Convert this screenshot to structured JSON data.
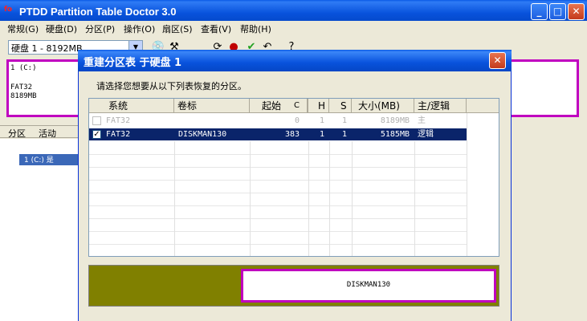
{
  "window": {
    "icon_text": "fo",
    "title": "PTDD Partition Table Doctor 3.0",
    "minimize_glyph": "_",
    "maximize_glyph": "□",
    "close_glyph": "✕"
  },
  "menu": [
    "常规(G)",
    "硬盘(D)",
    "分区(P)",
    "操作(O)",
    "扇区(S)",
    "查看(V)",
    "帮助(H)"
  ],
  "toolbar": {
    "disk_select": "硬盘 1 - 8192MB",
    "icons": [
      "disk-icon",
      "tools-icon",
      "separator",
      "refresh-icon",
      "stop-icon",
      "check-icon",
      "undo-icon",
      "separator",
      "help-icon"
    ]
  },
  "disk_map": {
    "partition_name": "1 (C:)",
    "filesystem": "FAT32",
    "size": "8189MB"
  },
  "partition_list": {
    "headers": [
      "分区",
      "活动"
    ],
    "row": "1 (C:) 是"
  },
  "dialog": {
    "title": "重建分区表 于硬盘 1",
    "close_glyph": "✕",
    "prompt": "请选择您想要从以下列表恢复的分区。",
    "columns": [
      "系统",
      "卷标",
      "起始",
      "C",
      "H",
      "S",
      "大小(MB)",
      "主/逻辑"
    ],
    "rows": [
      {
        "checked": false,
        "system": "FAT32",
        "label": "",
        "c": "0",
        "h": "1",
        "s": "1",
        "size": "8189MB",
        "type": "主"
      },
      {
        "checked": true,
        "system": "FAT32",
        "label": "DISKMAN130",
        "c": "383",
        "h": "1",
        "s": "1",
        "size": "5185MB",
        "type": "逻辑"
      }
    ],
    "preview_label": "DISKMAN130"
  },
  "colors": {
    "titlebar": "#0852dc",
    "partition_border": "#c000c0",
    "selected_row": "#0a246a",
    "preview_background": "#808000"
  }
}
